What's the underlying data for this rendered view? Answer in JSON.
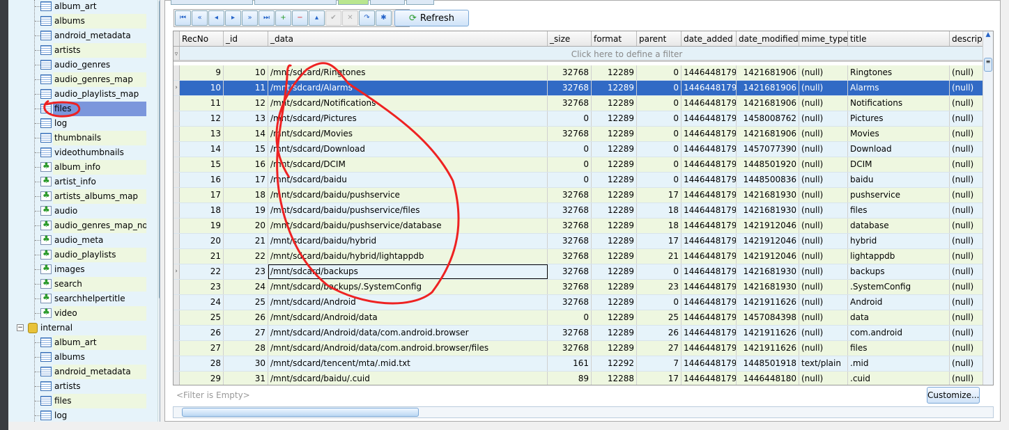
{
  "tree": {
    "items": [
      {
        "label": "album_art",
        "type": "table"
      },
      {
        "label": "albums",
        "type": "table"
      },
      {
        "label": "android_metadata",
        "type": "table"
      },
      {
        "label": "artists",
        "type": "table"
      },
      {
        "label": "audio_genres",
        "type": "table"
      },
      {
        "label": "audio_genres_map",
        "type": "table"
      },
      {
        "label": "audio_playlists_map",
        "type": "table"
      },
      {
        "label": "files",
        "type": "table",
        "selected": true
      },
      {
        "label": "log",
        "type": "table"
      },
      {
        "label": "thumbnails",
        "type": "table"
      },
      {
        "label": "videothumbnails",
        "type": "table"
      },
      {
        "label": "album_info",
        "type": "view"
      },
      {
        "label": "artist_info",
        "type": "view"
      },
      {
        "label": "artists_albums_map",
        "type": "view"
      },
      {
        "label": "audio",
        "type": "view"
      },
      {
        "label": "audio_genres_map_noi",
        "type": "view"
      },
      {
        "label": "audio_meta",
        "type": "view"
      },
      {
        "label": "audio_playlists",
        "type": "view"
      },
      {
        "label": "images",
        "type": "view"
      },
      {
        "label": "search",
        "type": "view"
      },
      {
        "label": "searchhelpertitle",
        "type": "view"
      },
      {
        "label": "video",
        "type": "view"
      }
    ],
    "db2": {
      "label": "internal"
    },
    "items2": [
      {
        "label": "album_art"
      },
      {
        "label": "albums"
      },
      {
        "label": "android_metadata"
      },
      {
        "label": "artists"
      },
      {
        "label": "files"
      },
      {
        "label": "log"
      }
    ]
  },
  "toolbar": {
    "buttons": [
      "first",
      "prev-page",
      "prev",
      "next",
      "next-page",
      "last",
      "insert",
      "delete",
      "edit",
      "post",
      "cancel",
      "refresh",
      "autoinc",
      "clear"
    ],
    "refresh_label": "Refresh"
  },
  "grid": {
    "columns": [
      "RecNo",
      "_id",
      "_data",
      "_size",
      "format",
      "parent",
      "date_added",
      "date_modified",
      "mime_type",
      "title",
      "descript"
    ],
    "filter_hint": "Click here to define a filter",
    "rows": [
      [
        "9",
        "10",
        "/mnt/sdcard/Ringtones",
        "32768",
        "12289",
        "0",
        "1446448179",
        "1421681906",
        "(null)",
        "Ringtones",
        "(null)"
      ],
      [
        "10",
        "11",
        "/mnt/sdcard/Alarms",
        "32768",
        "12289",
        "0",
        "1446448179",
        "1421681906",
        "(null)",
        "Alarms",
        "(null)"
      ],
      [
        "11",
        "12",
        "/mnt/sdcard/Notifications",
        "32768",
        "12289",
        "0",
        "1446448179",
        "1421681906",
        "(null)",
        "Notifications",
        "(null)"
      ],
      [
        "12",
        "13",
        "/mnt/sdcard/Pictures",
        "0",
        "12289",
        "0",
        "1446448179",
        "1458008762",
        "(null)",
        "Pictures",
        "(null)"
      ],
      [
        "13",
        "14",
        "/mnt/sdcard/Movies",
        "32768",
        "12289",
        "0",
        "1446448179",
        "1421681906",
        "(null)",
        "Movies",
        "(null)"
      ],
      [
        "14",
        "15",
        "/mnt/sdcard/Download",
        "0",
        "12289",
        "0",
        "1446448179",
        "1457077390",
        "(null)",
        "Download",
        "(null)"
      ],
      [
        "15",
        "16",
        "/mnt/sdcard/DCIM",
        "0",
        "12289",
        "0",
        "1446448179",
        "1448501920",
        "(null)",
        "DCIM",
        "(null)"
      ],
      [
        "16",
        "17",
        "/mnt/sdcard/baidu",
        "0",
        "12289",
        "0",
        "1446448179",
        "1448500836",
        "(null)",
        "baidu",
        "(null)"
      ],
      [
        "17",
        "18",
        "/mnt/sdcard/baidu/pushservice",
        "32768",
        "12289",
        "17",
        "1446448179",
        "1421681930",
        "(null)",
        "pushservice",
        "(null)"
      ],
      [
        "18",
        "19",
        "/mnt/sdcard/baidu/pushservice/files",
        "32768",
        "12289",
        "18",
        "1446448179",
        "1421681930",
        "(null)",
        "files",
        "(null)"
      ],
      [
        "19",
        "20",
        "/mnt/sdcard/baidu/pushservice/database",
        "32768",
        "12289",
        "18",
        "1446448179",
        "1421912046",
        "(null)",
        "database",
        "(null)"
      ],
      [
        "20",
        "21",
        "/mnt/sdcard/baidu/hybrid",
        "32768",
        "12289",
        "17",
        "1446448179",
        "1421912046",
        "(null)",
        "hybrid",
        "(null)"
      ],
      [
        "21",
        "22",
        "/mnt/sdcard/baidu/hybrid/lightappdb",
        "32768",
        "12289",
        "21",
        "1446448179",
        "1421912046",
        "(null)",
        "lightappdb",
        "(null)"
      ],
      [
        "22",
        "23",
        "/mnt/sdcard/backups",
        "32768",
        "12289",
        "0",
        "1446448179",
        "1421681930",
        "(null)",
        "backups",
        "(null)"
      ],
      [
        "23",
        "24",
        "/mnt/sdcard/backups/.SystemConfig",
        "32768",
        "12289",
        "23",
        "1446448179",
        "1421681930",
        "(null)",
        ".SystemConfig",
        "(null)"
      ],
      [
        "24",
        "25",
        "/mnt/sdcard/Android",
        "32768",
        "12289",
        "0",
        "1446448179",
        "1421911626",
        "(null)",
        "Android",
        "(null)"
      ],
      [
        "25",
        "26",
        "/mnt/sdcard/Android/data",
        "0",
        "12289",
        "25",
        "1446448179",
        "1457084398",
        "(null)",
        "data",
        "(null)"
      ],
      [
        "26",
        "27",
        "/mnt/sdcard/Android/data/com.android.browser",
        "32768",
        "12289",
        "26",
        "1446448179",
        "1421911626",
        "(null)",
        "com.android",
        "(null)"
      ],
      [
        "27",
        "28",
        "/mnt/sdcard/Android/data/com.android.browser/files",
        "32768",
        "12289",
        "27",
        "1446448179",
        "1421911626",
        "(null)",
        "files",
        "(null)"
      ],
      [
        "28",
        "30",
        "/mnt/sdcard/tencent/mta/.mid.txt",
        "161",
        "12292",
        "7",
        "1446448179",
        "1448501918",
        "text/plain",
        ".mid",
        "(null)"
      ],
      [
        "29",
        "31",
        "/mnt/sdcard/baidu/.cuid",
        "89",
        "12288",
        "17",
        "1446448179",
        "1446448180",
        "(null)",
        ".cuid",
        "(null)"
      ]
    ],
    "selected_recno": "10",
    "focused_recno": "22"
  },
  "footer": {
    "filter_status": "<Filter is Empty>",
    "customize_label": "Customize..."
  },
  "colors": {
    "selected_row": "#316ac5",
    "row_alt_green": "#eef7e0",
    "row_alt_blue": "#e6f3fa",
    "annotation": "#ee2222"
  }
}
